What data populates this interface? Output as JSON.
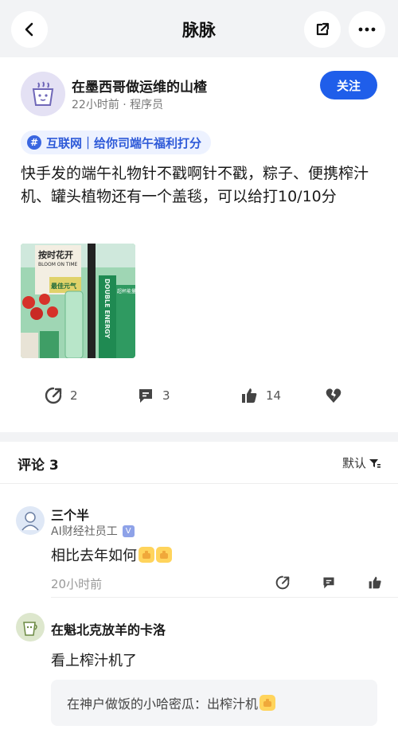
{
  "header": {
    "title": "脉脉",
    "back_icon": "chevron-left-icon",
    "share_icon": "share-external-icon",
    "more_icon": "more-dots-icon"
  },
  "post": {
    "author_name": "在墨西哥做运维的山楂",
    "author_meta": "22小时前 · 程序员",
    "follow_label": "关注",
    "topic": "互联网｜给你司端午福利打分",
    "topic_icon": "#",
    "text": "快手发的端午礼物针不戳啊针不戳，粽子、便携榨汁机、罐头植物还有一个盖毯，可以给打10/10分",
    "image_texts": {
      "top": "按时花开",
      "top_en": "BLOOM ON TIME",
      "mid": "最佳元气",
      "side": "DOUBLE ENERGY",
      "box": "超杯能量"
    },
    "actions": {
      "comment_count": "2",
      "reply_count": "3",
      "like_count": "14"
    }
  },
  "comments_section": {
    "title": "评论 3",
    "sort_label": "默认"
  },
  "comments": [
    {
      "name": "三个半",
      "sub": "AI财经社员工",
      "verified_badge": "V",
      "text": "相比去年如何",
      "time": "20小时前"
    },
    {
      "name": "在魁北克放羊的卡洛",
      "text": "看上榨汁机了",
      "reply": "在神户做饭的小哈密瓜：出榨汁机"
    }
  ],
  "colors": {
    "accent": "#1f5eea",
    "topic_bg": "#edf2ff",
    "topic_text": "#2e5ad8",
    "band": "#f2f3f5"
  }
}
